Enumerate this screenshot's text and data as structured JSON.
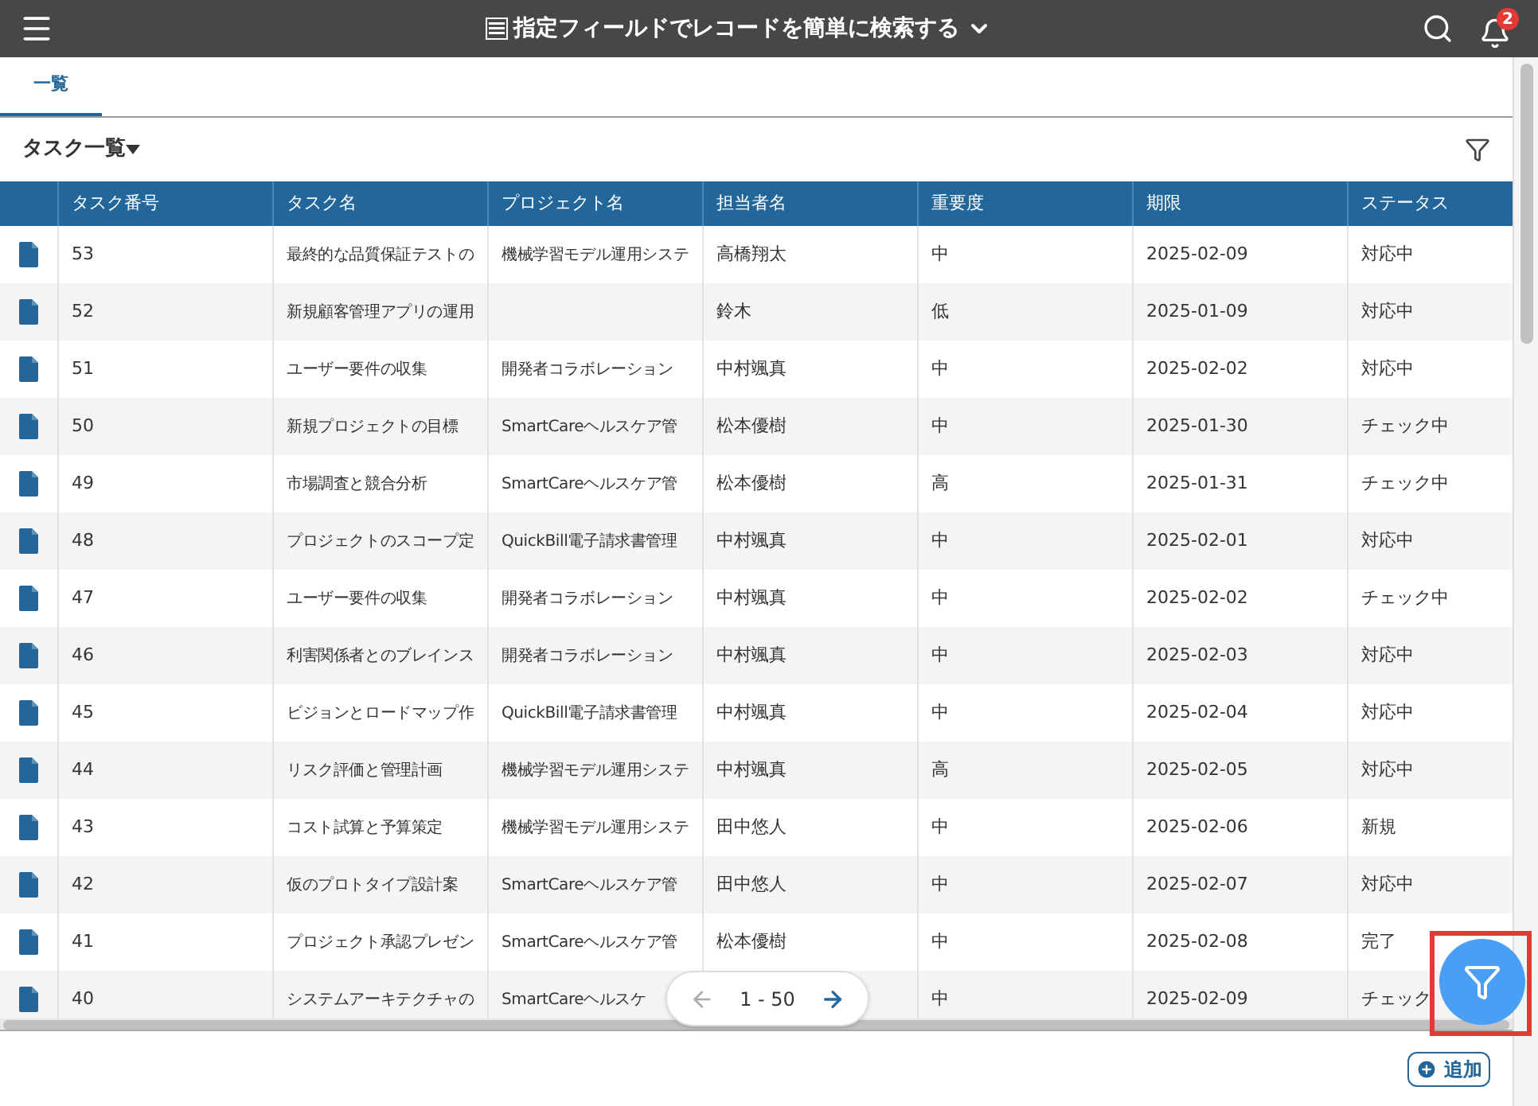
{
  "header": {
    "title": "指定フィールドでレコードを簡単に検索する",
    "notification_count": "2"
  },
  "tabs": [
    {
      "label": "一覧",
      "selected": true
    }
  ],
  "view": {
    "title": "タスク一覧"
  },
  "table": {
    "columns": [
      "タスク番号",
      "タスク名",
      "プロジェクト名",
      "担当者名",
      "重要度",
      "期限",
      "ステータス"
    ],
    "rows": [
      {
        "number": "53",
        "task": "最終的な品質保証テストの",
        "project": "機械学習モデル運用システ",
        "assignee": "高橋翔太",
        "importance": "中",
        "due": "2025-02-09",
        "status": "対応中"
      },
      {
        "number": "52",
        "task": "新規顧客管理アプリの運用",
        "assignee": "鈴木",
        "importance": "低",
        "due": "2025-01-09",
        "status": "対応中"
      },
      {
        "number": "51",
        "task": "ユーザー要件の収集",
        "project": "開発者コラボレーション",
        "assignee": "中村颯真",
        "importance": "中",
        "due": "2025-02-02",
        "status": "対応中"
      },
      {
        "number": "50",
        "task": "新規プロジェクトの目標",
        "project": "SmartCareヘルスケア管",
        "assignee": "松本優樹",
        "importance": "中",
        "due": "2025-01-30",
        "status": "チェック中"
      },
      {
        "number": "49",
        "task": "市場調査と競合分析",
        "project": "SmartCareヘルスケア管",
        "assignee": "松本優樹",
        "importance": "高",
        "due": "2025-01-31",
        "status": "チェック中"
      },
      {
        "number": "48",
        "task": "プロジェクトのスコープ定",
        "project": "QuickBill電子請求書管理",
        "assignee": "中村颯真",
        "importance": "中",
        "due": "2025-02-01",
        "status": "対応中"
      },
      {
        "number": "47",
        "task": "ユーザー要件の収集",
        "project": "開発者コラボレーション",
        "assignee": "中村颯真",
        "importance": "中",
        "due": "2025-02-02",
        "status": "チェック中"
      },
      {
        "number": "46",
        "task": "利害関係者とのブレインス",
        "project": "開発者コラボレーション",
        "assignee": "中村颯真",
        "importance": "中",
        "due": "2025-02-03",
        "status": "対応中"
      },
      {
        "number": "45",
        "task": "ビジョンとロードマップ作",
        "project": "QuickBill電子請求書管理",
        "assignee": "中村颯真",
        "importance": "中",
        "due": "2025-02-04",
        "status": "対応中"
      },
      {
        "number": "44",
        "task": "リスク評価と管理計画",
        "project": "機械学習モデル運用システ",
        "assignee": "中村颯真",
        "importance": "高",
        "due": "2025-02-05",
        "status": "対応中"
      },
      {
        "number": "43",
        "task": "コスト試算と予算策定",
        "project": "機械学習モデル運用システ",
        "assignee": "田中悠人",
        "importance": "中",
        "due": "2025-02-06",
        "status": "新規"
      },
      {
        "number": "42",
        "task": "仮のプロトタイプ設計案",
        "project": "SmartCareヘルスケア管",
        "assignee": "田中悠人",
        "importance": "中",
        "due": "2025-02-07",
        "status": "対応中"
      },
      {
        "number": "41",
        "task": "プロジェクト承認プレゼン",
        "project": "SmartCareヘルスケア管",
        "assignee": "松本優樹",
        "importance": "中",
        "due": "2025-02-08",
        "status": "完了"
      },
      {
        "number": "40",
        "task": "システムアーキテクチャの",
        "project": "SmartCareヘルスケ",
        "importance": "中",
        "due": "2025-02-09",
        "status": "チェック"
      }
    ]
  },
  "pager": {
    "range": "1 - 50",
    "prev_disabled": true,
    "next_disabled": false
  },
  "add_button": {
    "label": "追加"
  }
}
